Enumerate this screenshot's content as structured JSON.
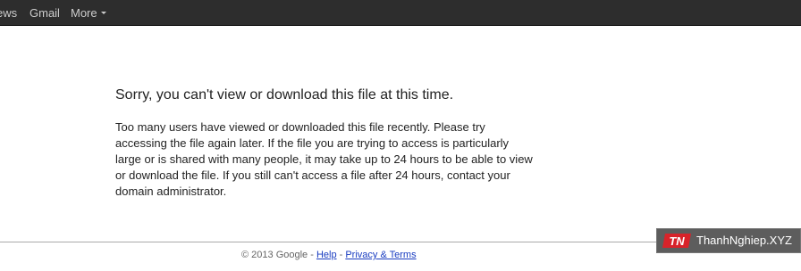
{
  "topbar": {
    "links": {
      "news": "ews",
      "gmail": "Gmail",
      "more": "More"
    }
  },
  "error": {
    "title": "Sorry, you can't view or download this file at this time.",
    "message": "Too many users have viewed or downloaded this file recently. Please try accessing the file again later. If the file you are trying to access is particularly large or is shared with many people, it may take up to 24 hours to be able to view or download the file. If you still can't access a file after 24 hours, contact your domain administrator."
  },
  "footer": {
    "copyright": "© 2013 Google - ",
    "help": "Help",
    "separator": " - ",
    "privacy": "Privacy & Terms"
  },
  "watermark": {
    "logo": "TN",
    "text": "ThanhNghiep.XYZ"
  },
  "colors": {
    "topbar_bg": "#2d2d2d",
    "link_blue": "#1a3dc1",
    "watermark_red": "#d8232a"
  }
}
